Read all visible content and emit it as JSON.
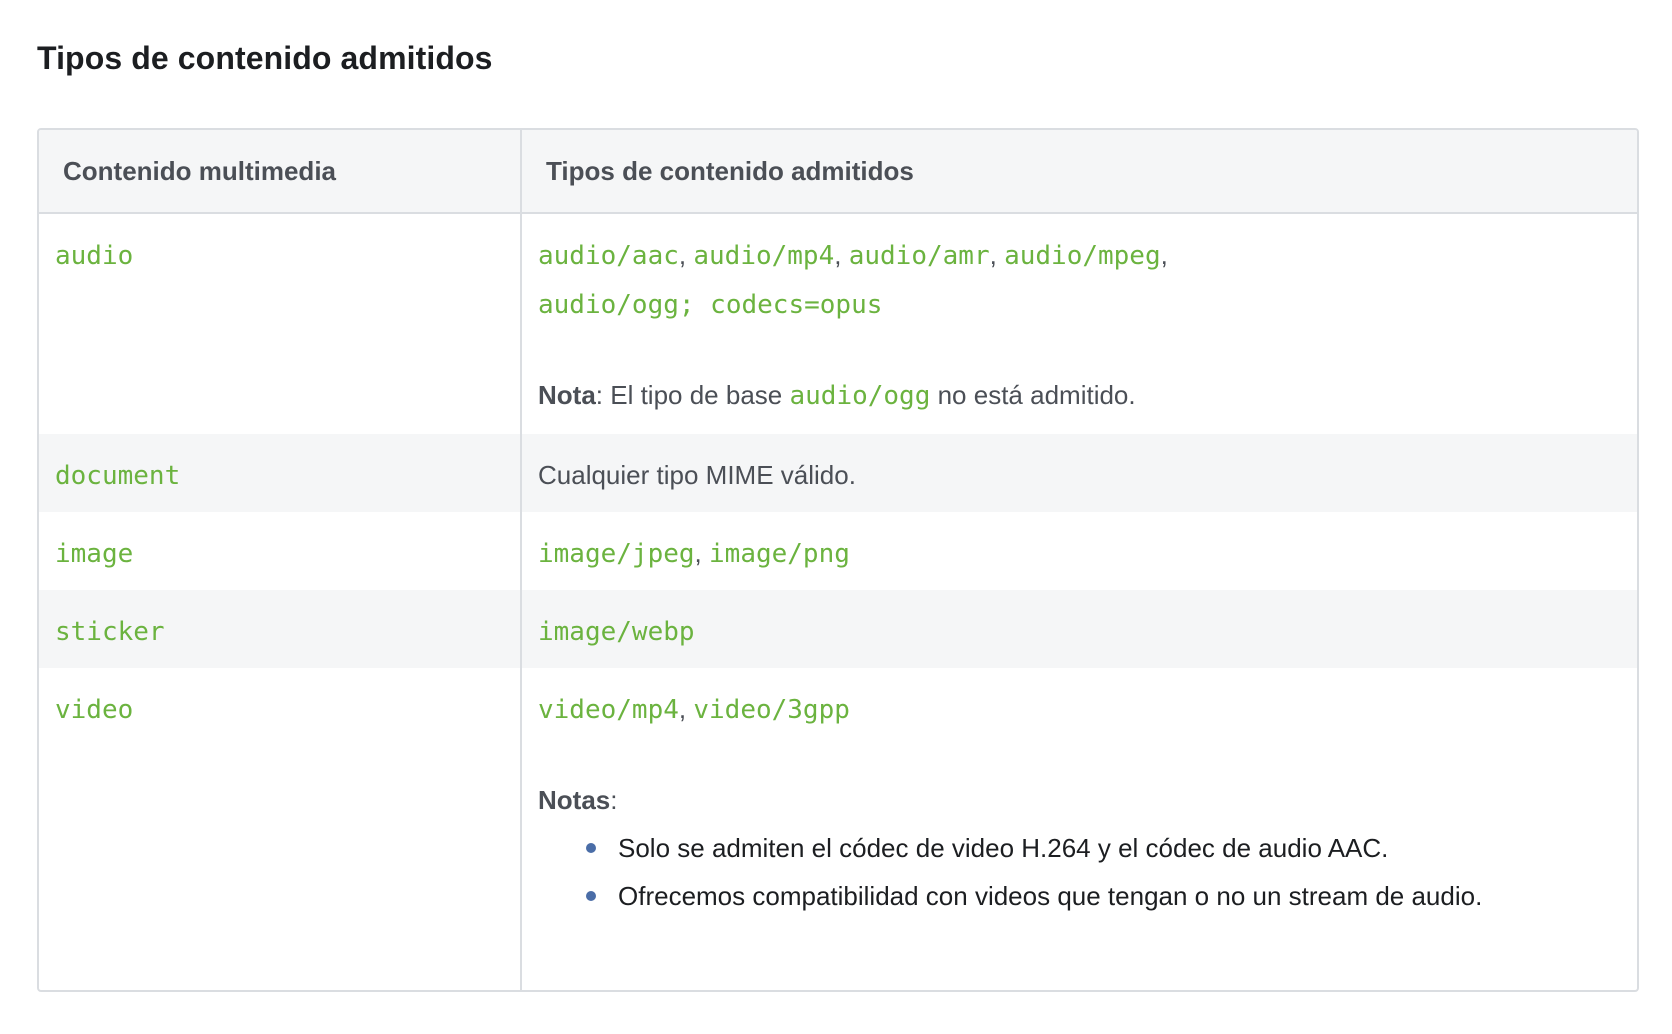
{
  "page": {
    "title": "Tipos de contenido admitidos"
  },
  "table": {
    "headers": [
      "Contenido multimedia",
      "Tipos de contenido admitidos"
    ],
    "rows": {
      "audio": {
        "name": "audio",
        "types": [
          "audio/aac",
          "audio/mp4",
          "audio/amr",
          "audio/mpeg",
          "audio/ogg; codecs=opus"
        ],
        "separator": ",",
        "note_label": "Nota",
        "note_colon": ":",
        "note_prefix": " El tipo de base ",
        "note_code": "audio/ogg",
        "note_suffix": " no está admitido."
      },
      "document": {
        "name": "document",
        "text": "Cualquier tipo MIME válido."
      },
      "image": {
        "name": "image",
        "types": [
          "image/jpeg",
          "image/png"
        ]
      },
      "sticker": {
        "name": "sticker",
        "types": [
          "image/webp"
        ]
      },
      "video": {
        "name": "video",
        "types": [
          "video/mp4",
          "video/3gpp"
        ],
        "notes_label": "Notas",
        "notes_colon": ":",
        "notes": [
          "Solo se admiten el códec de video H.264 y el códec de audio AAC.",
          "Ofrecemos compatibilidad con videos que tengan o no un stream de audio."
        ]
      }
    }
  },
  "colors": {
    "code": "#6bb33f",
    "text": "#4b4f56",
    "header_bg": "#f5f6f7",
    "border": "#dadde1",
    "bullet": "#4a6da7"
  }
}
